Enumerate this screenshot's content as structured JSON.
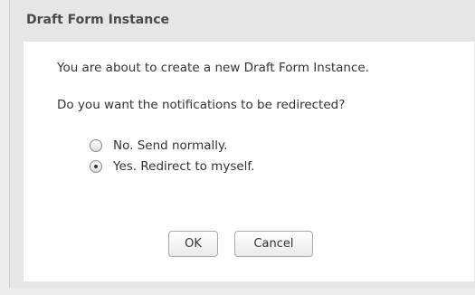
{
  "dialog": {
    "title": "Draft Form Instance",
    "message": "You are about to create a new Draft Form Instance.",
    "question": "Do you want the notifications to be redirected?",
    "options": [
      {
        "label": "No. Send normally.",
        "selected": false
      },
      {
        "label": "Yes. Redirect to myself.",
        "selected": true
      }
    ],
    "buttons": {
      "ok_label": "OK",
      "cancel_label": "Cancel"
    }
  }
}
